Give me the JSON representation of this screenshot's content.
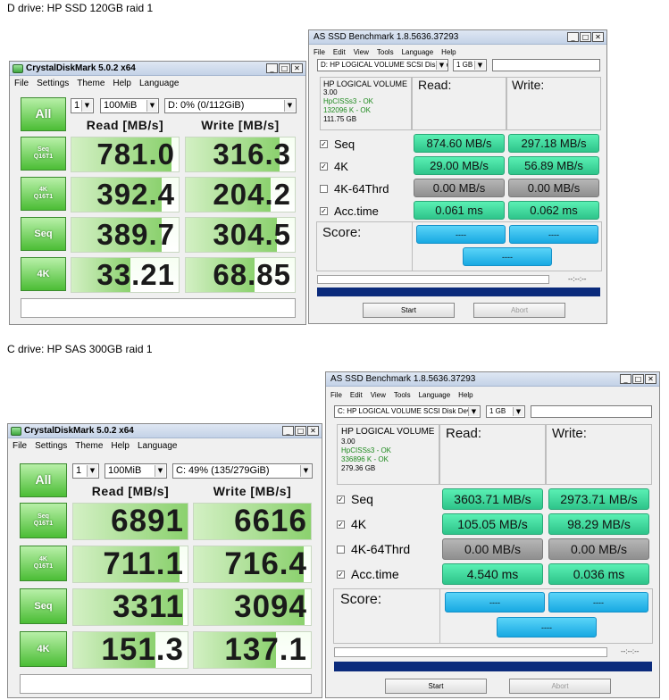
{
  "captions": {
    "d": "D drive: HP SSD 120GB raid 1",
    "c": "C drive: HP SAS 300GB raid 1"
  },
  "cdm": {
    "title": "CrystalDiskMark 5.0.2 x64",
    "menu": [
      "File",
      "Settings",
      "Theme",
      "Help",
      "Language"
    ],
    "all_label": "All",
    "read_header": "Read [MB/s]",
    "write_header": "Write [MB/s]",
    "d": {
      "count": "1",
      "size": "100MiB",
      "drive": "D: 0% (0/112GiB)",
      "rows": [
        {
          "label": [
            "Seq",
            "Q16T1"
          ],
          "read": "781.0",
          "write": "316.3",
          "read_frac": 0.93,
          "write_frac": 0.86
        },
        {
          "label": [
            "4K",
            "Q16T1"
          ],
          "read": "392.4",
          "write": "204.2",
          "read_frac": 0.84,
          "write_frac": 0.78
        },
        {
          "label": [
            "Seq"
          ],
          "read": "389.7",
          "write": "304.5",
          "read_frac": 0.84,
          "write_frac": 0.84
        },
        {
          "label": [
            "4K"
          ],
          "read": "33.21",
          "write": "68.85",
          "read_frac": 0.55,
          "write_frac": 0.63
        }
      ]
    },
    "c": {
      "count": "1",
      "size": "100MiB",
      "drive": "C: 49% (135/279GiB)",
      "rows": [
        {
          "label": [
            "Seq",
            "Q16T1"
          ],
          "read": "6891",
          "write": "6616",
          "read_frac": 1.0,
          "write_frac": 1.0
        },
        {
          "label": [
            "4K",
            "Q16T1"
          ],
          "read": "711.1",
          "write": "716.4",
          "read_frac": 0.93,
          "write_frac": 0.94
        },
        {
          "label": [
            "Seq"
          ],
          "read": "3311",
          "write": "3094",
          "read_frac": 0.96,
          "write_frac": 0.95
        },
        {
          "label": [
            "4K"
          ],
          "read": "151.3",
          "write": "137.1",
          "read_frac": 0.72,
          "write_frac": 0.7
        }
      ]
    }
  },
  "asssd": {
    "title": "AS SSD Benchmark 1.8.5636.37293",
    "menu": [
      "File",
      "Edit",
      "View",
      "Tools",
      "Language",
      "Help"
    ],
    "read": "Read:",
    "write": "Write:",
    "score": "Score:",
    "rows_labels": [
      "Seq",
      "4K",
      "4K-64Thrd",
      "Acc.time"
    ],
    "start": "Start",
    "abort": "Abort",
    "d": {
      "drive": "D: HP LOGICAL VOLUME SCSI Disk Dev",
      "size": "1 GB",
      "info": [
        "HP LOGICAL VOLUME",
        "3.00",
        "HpCISSs3 - OK",
        "132096 K - OK",
        "111.75 GB"
      ],
      "read": [
        "874.60 MB/s",
        "29.00 MB/s",
        "0.00 MB/s",
        "0.061 ms"
      ],
      "write": [
        "297.18 MB/s",
        "56.89 MB/s",
        "0.00 MB/s",
        "0.062 ms"
      ],
      "checked": [
        true,
        true,
        false,
        true
      ],
      "score_read": "----",
      "score_write": "----",
      "score_total": "----",
      "timer": "--:--:--"
    },
    "c": {
      "drive": "C: HP LOGICAL VOLUME SCSI Disk Dev",
      "size": "1 GB",
      "info": [
        "HP LOGICAL VOLUME",
        "3.00",
        "HpCISSs3 - OK",
        "336896 K - OK",
        "279.36 GB"
      ],
      "read": [
        "3603.71 MB/s",
        "105.05 MB/s",
        "0.00 MB/s",
        "4.540 ms"
      ],
      "write": [
        "2973.71 MB/s",
        "98.29 MB/s",
        "0.00 MB/s",
        "0.036 ms"
      ],
      "checked": [
        true,
        true,
        false,
        true
      ],
      "score_read": "----",
      "score_write": "----",
      "score_total": "----",
      "timer": "--:--:--"
    }
  },
  "colors": {
    "green": "#4bbd35",
    "teal": "#2ec48a",
    "blue": "#18a9e2",
    "navy": "#0b2b7c"
  }
}
